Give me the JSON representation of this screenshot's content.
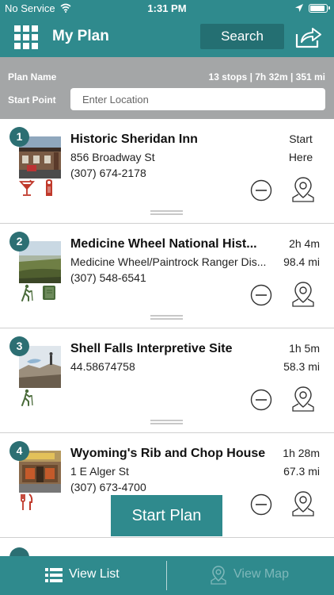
{
  "status_bar": {
    "carrier": "No Service",
    "time": "1:31 PM"
  },
  "header": {
    "title": "My Plan",
    "search_label": "Search"
  },
  "plan": {
    "name_label": "Plan Name",
    "summary": "13 stops | 7h 32m | 351 mi",
    "start_label": "Start Point",
    "location_placeholder": "Enter Location"
  },
  "stops": [
    {
      "number": "1",
      "name": "Historic Sheridan Inn",
      "address": "856 Broadway St",
      "phone": "(307) 674-2178",
      "time": "Start",
      "distance": "Here",
      "amenities": [
        "cocktail-icon",
        "door-hanger-icon"
      ]
    },
    {
      "number": "2",
      "name": "Medicine Wheel National Hist...",
      "address": "Medicine Wheel/Paintrock Ranger Dis...",
      "phone": "(307) 548-6541",
      "time": "2h 4m",
      "distance": "98.4 mi",
      "amenities": [
        "hiker-icon",
        "book-icon"
      ]
    },
    {
      "number": "3",
      "name": "Shell Falls Interpretive Site",
      "address": "44.58674758",
      "phone": "",
      "time": "1h 5m",
      "distance": "58.3 mi",
      "amenities": [
        "hiker-icon"
      ]
    },
    {
      "number": "4",
      "name": "Wyoming's Rib and Chop House",
      "address": "1 E Alger St",
      "phone": "(307) 673-4700",
      "time": "1h 28m",
      "distance": "67.3 mi",
      "amenities": [
        "fork-knife-icon"
      ]
    }
  ],
  "start_plan_label": "Start Plan",
  "tabs": {
    "list_label": "View List",
    "map_label": "View Map"
  },
  "colors": {
    "teal": "#2f8a8d",
    "dark_teal": "#2c6f73",
    "gray_panel": "#a4a6a7",
    "icon_red": "#c0392b",
    "icon_green": "#4a6b3a"
  }
}
